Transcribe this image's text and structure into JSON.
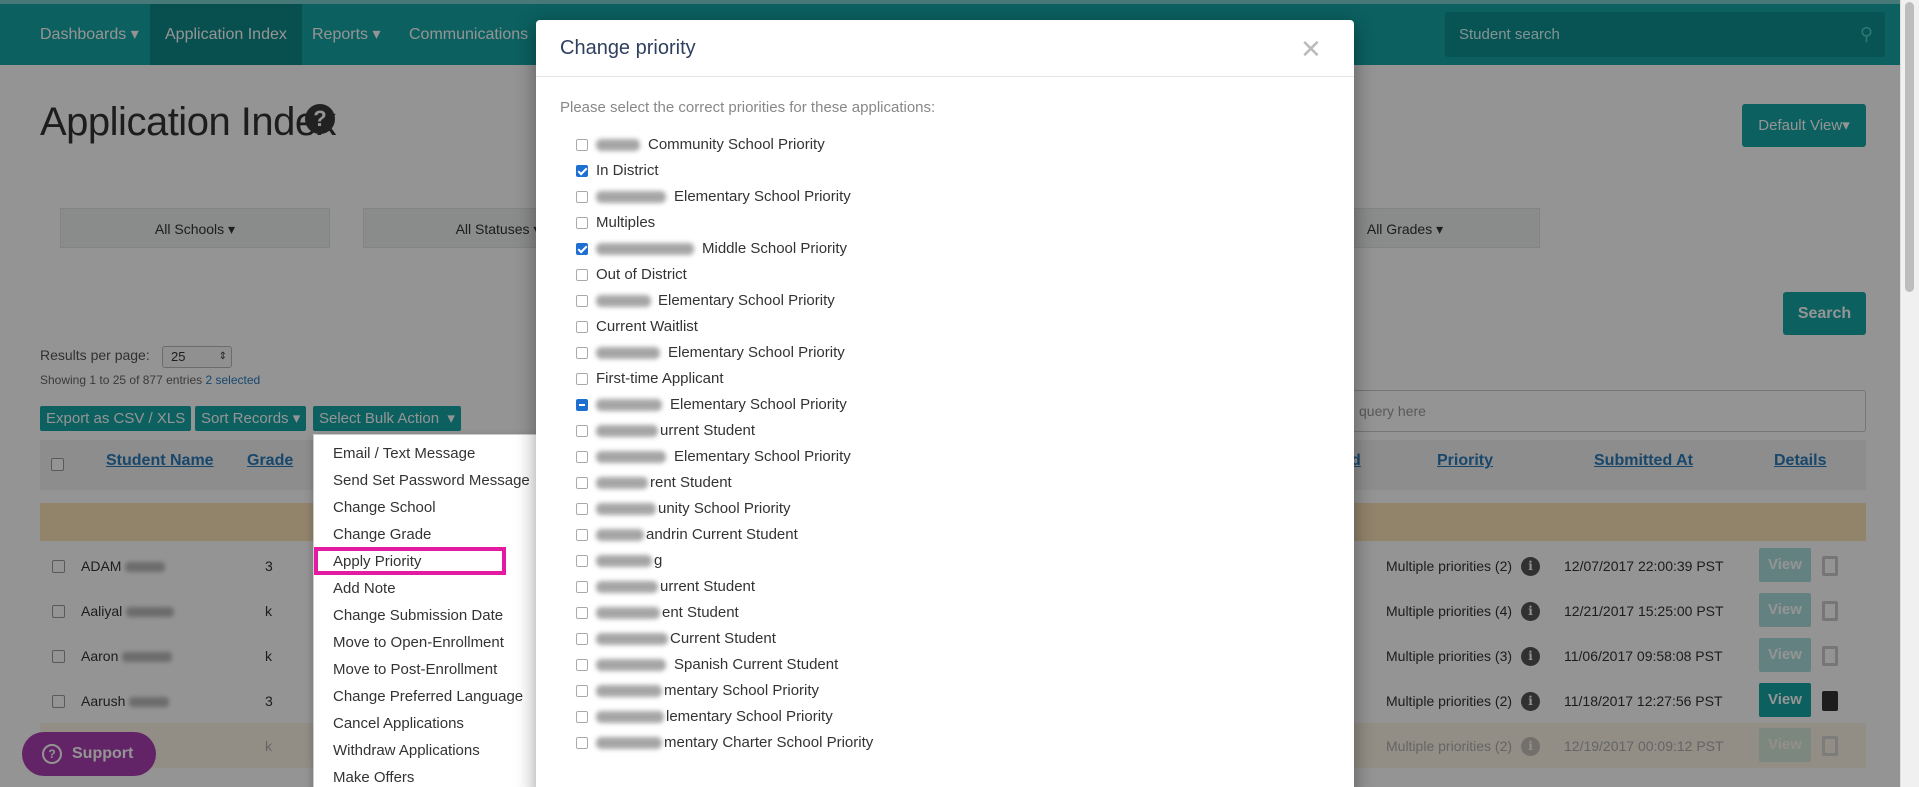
{
  "nav": {
    "items": [
      "Dashboards",
      "Application Index",
      "Reports",
      "Communications"
    ],
    "search_placeholder": "Student search"
  },
  "page": {
    "title": "Application Index",
    "default_view": "Default View",
    "search_button": "Search",
    "query_placeholder": "query here"
  },
  "filters": {
    "schools": "All Schools",
    "statuses": "All Statuses",
    "grades": "All Grades"
  },
  "results": {
    "label": "Results per page:",
    "value": "25",
    "showing": "Showing 1 to 25 of 877 entries",
    "selected": "2 selected"
  },
  "toolbar": {
    "export": "Export as CSV / XLS",
    "sort": "Sort Records",
    "bulk": "Select Bulk Action"
  },
  "table": {
    "headers": {
      "name": "Student Name",
      "grade": "Grade",
      "d": "d",
      "priority": "Priority",
      "submitted": "Submitted At",
      "details": "Details"
    },
    "view_label": "View",
    "rows": [
      {
        "name": "ADAM",
        "grade": "3",
        "priority": "Multiple priorities (2)",
        "submitted": "12/07/2017 22:00:39 PST"
      },
      {
        "name": "Aaliyal",
        "grade": "k",
        "priority": "Multiple priorities (4)",
        "submitted": "12/21/2017 15:25:00 PST"
      },
      {
        "name": "Aaron",
        "grade": "k",
        "priority": "Multiple priorities (3)",
        "submitted": "11/06/2017 09:58:08 PST"
      },
      {
        "name": "Aarush",
        "grade": "3",
        "priority": "Multiple priorities (2)",
        "submitted": "11/18/2017 12:27:56 PST"
      },
      {
        "name": "",
        "grade": "k",
        "priority": "Multiple priorities (2)",
        "submitted": "12/19/2017 00:09:12 PST"
      }
    ]
  },
  "bulk_menu": [
    "Email / Text Message",
    "Send Set Password Message",
    "Change School",
    "Change Grade",
    "Apply Priority",
    "Add Note",
    "Change Submission Date",
    "Move to Open-Enrollment",
    "Move to Post-Enrollment",
    "Change Preferred Language",
    "Cancel Applications",
    "Withdraw Applications",
    "Make Offers"
  ],
  "modal": {
    "title": "Change priority",
    "instructions": "Please select the correct priorities for these applications:",
    "priorities": [
      {
        "label": "Community School Priority",
        "state": "unchecked"
      },
      {
        "label": "In District",
        "state": "checked"
      },
      {
        "label": "Elementary School Priority",
        "state": "unchecked"
      },
      {
        "label": "Multiples",
        "state": "unchecked"
      },
      {
        "label": "Middle School Priority",
        "state": "checked"
      },
      {
        "label": "Out of District",
        "state": "unchecked"
      },
      {
        "label": "Elementary School Priority",
        "state": "unchecked"
      },
      {
        "label": "Current Waitlist",
        "state": "unchecked"
      },
      {
        "label": "Elementary School Priority",
        "state": "unchecked"
      },
      {
        "label": "First-time Applicant",
        "state": "unchecked"
      },
      {
        "label": "Elementary School Priority",
        "state": "indeterminate"
      },
      {
        "label": "urrent Student",
        "state": "unchecked"
      },
      {
        "label": "Elementary School Priority",
        "state": "unchecked"
      },
      {
        "label": "rent Student",
        "state": "unchecked"
      },
      {
        "label": "unity School Priority",
        "state": "unchecked"
      },
      {
        "label": "andrin Current Student",
        "state": "unchecked"
      },
      {
        "label": "g",
        "state": "unchecked"
      },
      {
        "label": "urrent Student",
        "state": "unchecked"
      },
      {
        "label": "ent Student",
        "state": "unchecked"
      },
      {
        "label": "Current Student",
        "state": "unchecked"
      },
      {
        "label": "Spanish Current Student",
        "state": "unchecked"
      },
      {
        "label": "mentary School Priority",
        "state": "unchecked"
      },
      {
        "label": "lementary School Priority",
        "state": "unchecked"
      },
      {
        "label": "mentary Charter School Priority",
        "state": "unchecked"
      }
    ]
  },
  "support": "Support",
  "colors": {
    "teal": "#16a6a6",
    "highlight": "#e41ba2",
    "support": "#a93fb0"
  }
}
